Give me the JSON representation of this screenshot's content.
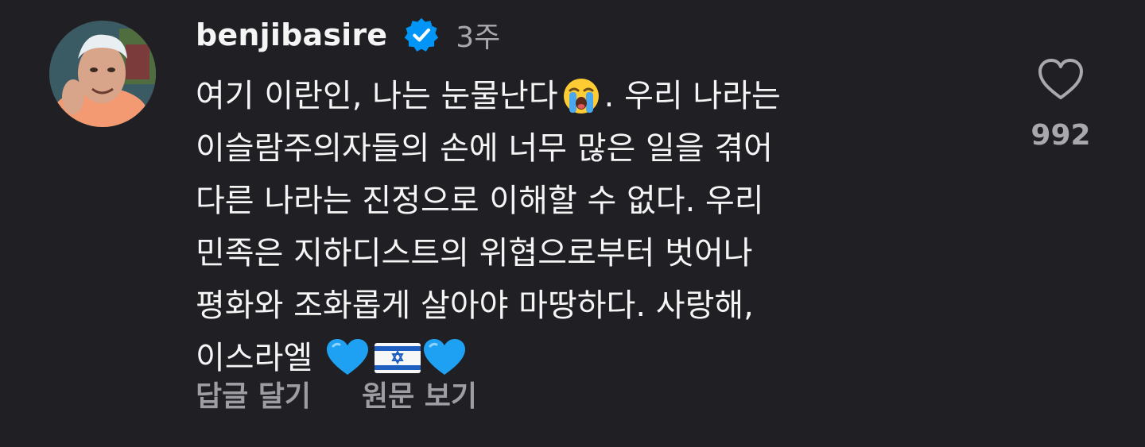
{
  "comment": {
    "username": "benjibasire",
    "verified_icon": "verified-badge-icon",
    "timestamp": "3주",
    "lines": [
      "여기 이란인, 나는 눈물난다",
      ". 우리 나라는",
      "이슬람주의자들의 손에 너무 많은 일을 겪어",
      "다른 나라는 진정으로 이해할 수 없다. 우리",
      "민족은 지하디스트의 위협으로부터 벗어나",
      "평화와 조화롭게 살아야 마땅하다. 사랑해,",
      "이스라엘"
    ],
    "emojis": [
      "loudly-crying-face-icon",
      "blue-heart-icon",
      "israel-flag-icon",
      "blue-heart-icon"
    ],
    "actions": {
      "reply": "답글 달기",
      "see_original": "원문 보기"
    },
    "like": {
      "icon": "heart-icon",
      "count": "992"
    }
  },
  "colors": {
    "background": "#1f1f24",
    "text": "#f5f5f5",
    "muted": "#a8a8ad",
    "verified": "#0095f6"
  }
}
